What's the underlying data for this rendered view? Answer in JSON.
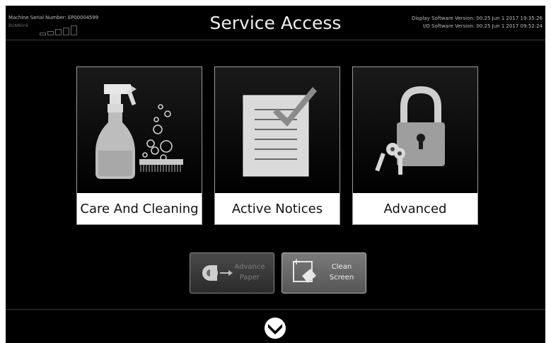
{
  "header": {
    "serial_number": "Machine Serial Number: EP00004599",
    "bunnlink_label": "BUNNlink",
    "title": "Service Access",
    "display_version": "Display Software Version: 00.25 Jun 1 2017 19:35:26",
    "io_version": "I/O Software Version: 00.25 Jun 1 2017 09:52:24"
  },
  "tiles": [
    {
      "label": "Care And Cleaning",
      "icon": "spray-bottle-brush-icon"
    },
    {
      "label": "Active Notices",
      "icon": "checklist-document-icon"
    },
    {
      "label": "Advanced",
      "icon": "padlock-keys-icon"
    }
  ],
  "buttons": {
    "advance_paper": {
      "line1": "Advance",
      "line2": "Paper",
      "icon": "paper-roll-icon",
      "enabled": false
    },
    "clean_screen": {
      "line1": "Clean",
      "line2": "Screen",
      "icon": "wipe-screen-icon",
      "enabled": true
    }
  },
  "footer": {
    "icon": "chevron-down-icon"
  },
  "colors": {
    "background": "#000000",
    "tile_label_bg": "#ffffff",
    "text": "#eeeeee"
  }
}
